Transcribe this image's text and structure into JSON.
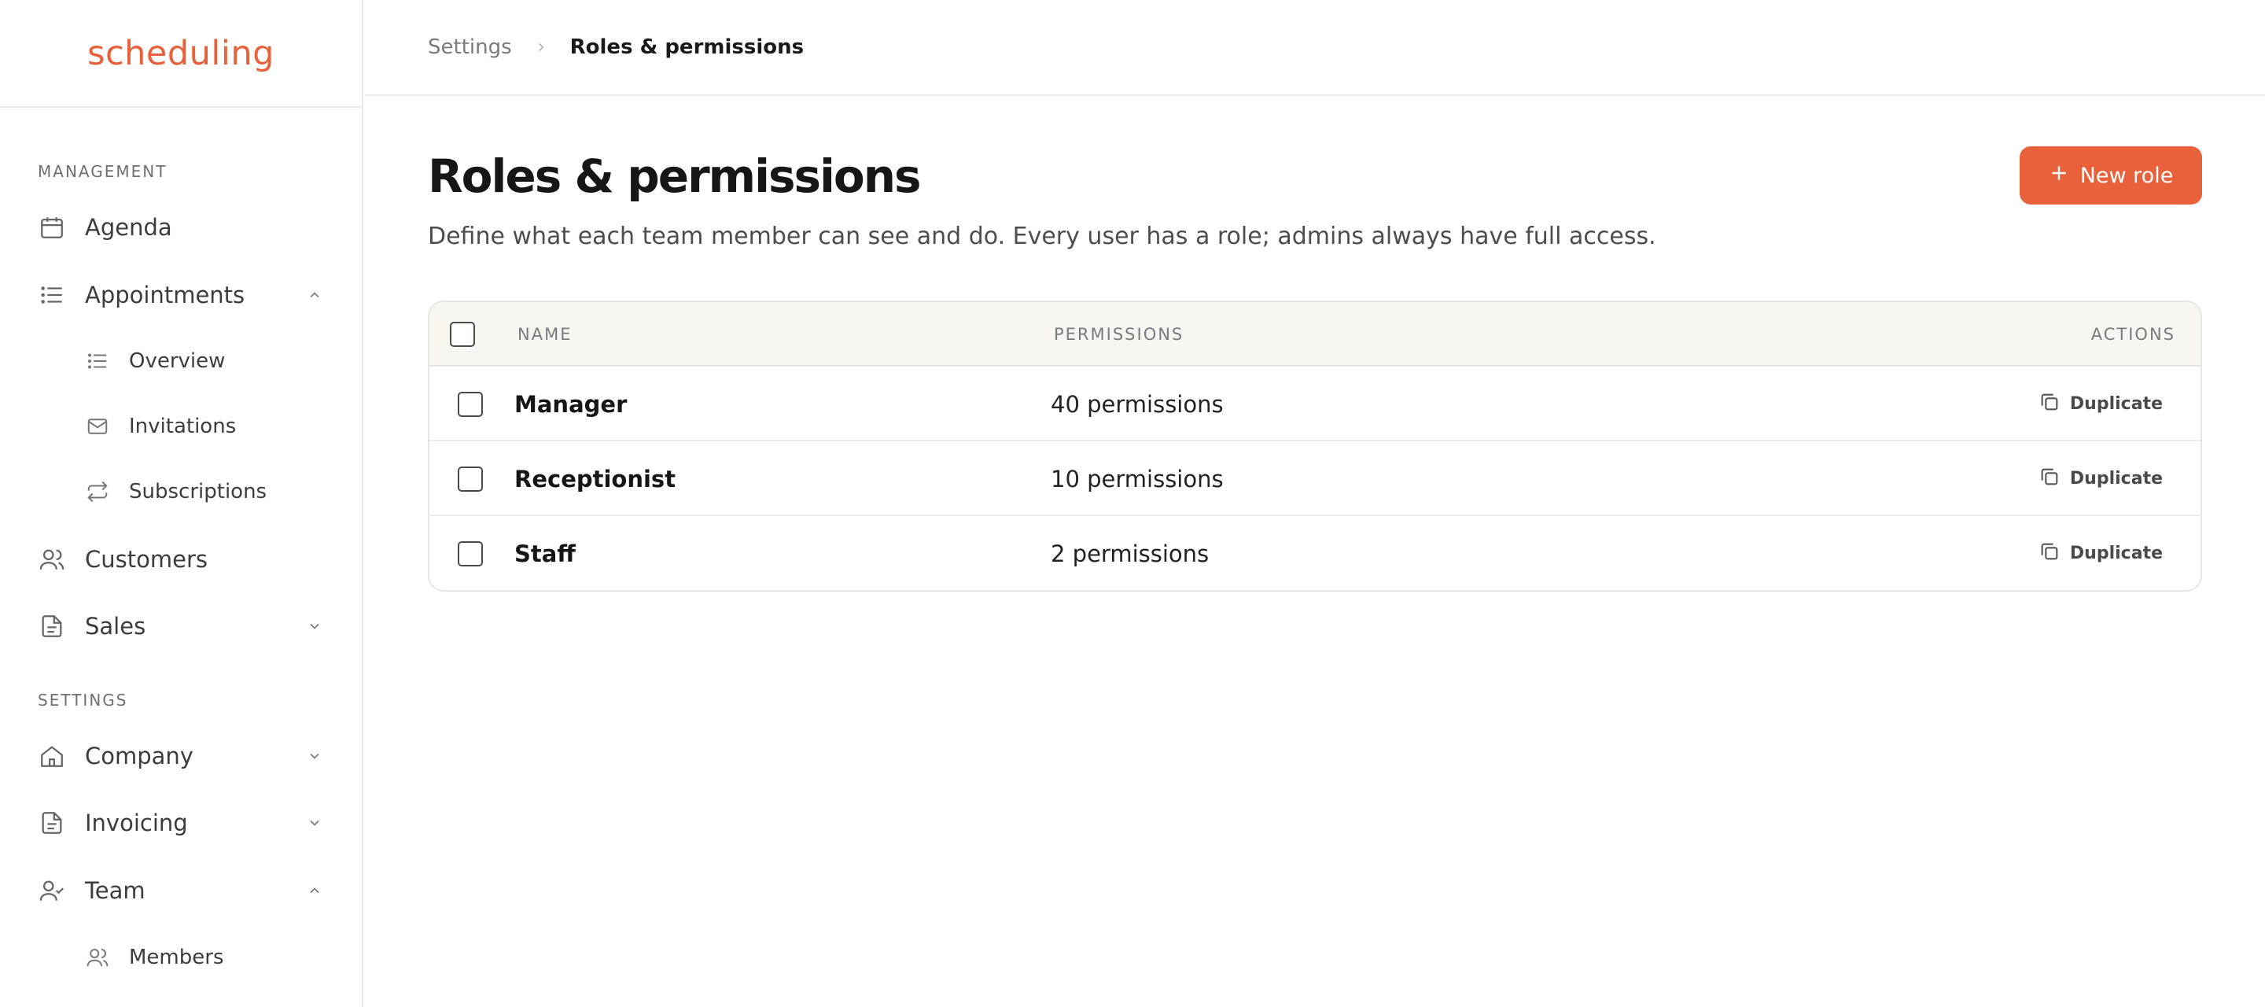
{
  "app": {
    "logo": "scheduling"
  },
  "sidebar": {
    "management_label": "MANAGEMENT",
    "settings_label": "SETTINGS",
    "items": {
      "agenda": "Agenda",
      "appointments": "Appointments",
      "overview": "Overview",
      "invitations": "Invitations",
      "subscriptions": "Subscriptions",
      "customers": "Customers",
      "sales": "Sales",
      "company": "Company",
      "invoicing": "Invoicing",
      "team": "Team",
      "members": "Members"
    }
  },
  "breadcrumb": {
    "parent": "Settings",
    "current": "Roles & permissions"
  },
  "page": {
    "title": "Roles & permissions",
    "description": "Define what each team member can see and do. Every user has a role; admins always have full access.",
    "new_role_label": "New role"
  },
  "table": {
    "headers": {
      "name": "NAME",
      "permissions": "PERMISSIONS",
      "actions": "ACTIONS"
    },
    "rows": [
      {
        "name": "Manager",
        "permissions": "40 permissions",
        "action": "Duplicate"
      },
      {
        "name": "Receptionist",
        "permissions": "10 permissions",
        "action": "Duplicate"
      },
      {
        "name": "Staff",
        "permissions": "2 permissions",
        "action": "Duplicate"
      }
    ]
  },
  "colors": {
    "accent": "#e8613a",
    "header_bg": "#f8f5f1",
    "border": "#e6e6e6"
  }
}
